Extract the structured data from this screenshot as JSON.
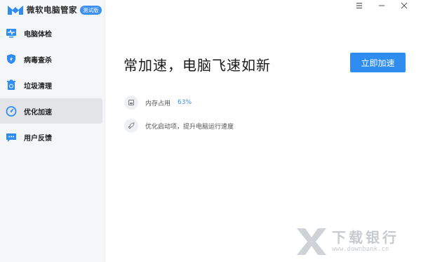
{
  "app": {
    "name": "微软电脑管家",
    "badge": "测试版",
    "brand_color": "#2f8df2"
  },
  "window_controls": {
    "menu_icon": "menu-icon",
    "minimize_icon": "minimize-icon",
    "close_icon": "close-icon"
  },
  "sidebar": {
    "items": [
      {
        "label": "电脑体检",
        "icon": "heartbeat-monitor-icon",
        "active": false
      },
      {
        "label": "病毒查杀",
        "icon": "shield-bolt-icon",
        "active": false
      },
      {
        "label": "垃圾清理",
        "icon": "recycle-bin-icon",
        "active": false
      },
      {
        "label": "优化加速",
        "icon": "speedometer-icon",
        "active": true
      },
      {
        "label": "用户反馈",
        "icon": "chat-bubble-icon",
        "active": false
      }
    ]
  },
  "main": {
    "headline": "常加速，电脑飞速如新",
    "boost_button": "立即加速",
    "memory": {
      "label": "内存占用",
      "value": "63%",
      "icon": "memory-chip-icon"
    },
    "startup": {
      "label": "优化启动项，提升电脑运行速度",
      "icon": "rocket-icon"
    }
  },
  "watermark": {
    "title": "下载银行",
    "url": "www.downbank.cn"
  }
}
